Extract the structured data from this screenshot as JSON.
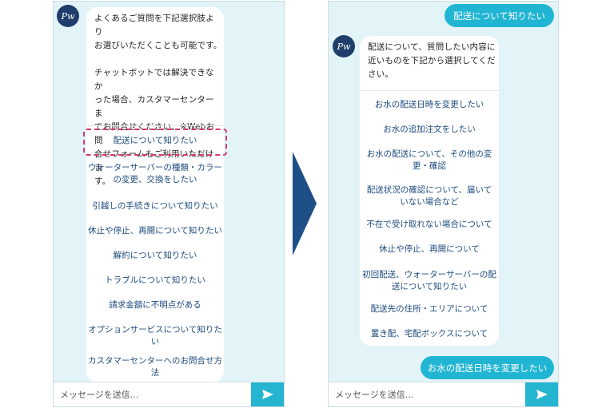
{
  "left_chat": {
    "avatar_text": "Pw",
    "intro_text": "よくあるご質問を下記選択肢より\nお選びいただくことも可能です。\n\nチャットボットでは解決できなか\nった場合、カスタマーセンターま\nでお問合せください。※Webお問\n合せフォームもご利用いただけま\nす。",
    "options": [
      "配送について知りたい",
      "ウォーターサーバーの種類・カラー\nの変更、交換をしたい",
      "引越しの手続きについて知りたい",
      "休止や停止、再開について知りたい",
      "解約について知りたい",
      "トラブルについて知りたい",
      "請求金額に不明点がある",
      "オプションサービスについて知りた\nい",
      "カスタマーセンターへのお問合せ方\n法"
    ],
    "input_placeholder": "メッセージを送信..."
  },
  "right_chat": {
    "user_message_1": "配送について知りたい",
    "avatar_text": "Pw",
    "bot_text": "配送について、質問したい内容に\n近いものを下記から選択してくだ\nさい。",
    "options": [
      "お水の配送日時を変更したい",
      "お水の追加注文をしたい",
      "お水の配送について、その他の変\n更・確認",
      "配送状況の確認について、届いて\nいない場合など",
      "不在で受け取れない場合について",
      "休止や停止、再開について",
      "初回配送、ウォーターサーバーの配\n送について知りたい",
      "配送先の住所・エリアについて",
      "置き配、宅配ボックスについて"
    ],
    "user_message_2": "お水の配送日時を変更したい",
    "input_placeholder": "メッセージを送信..."
  },
  "colors": {
    "panel_bg": "#e3f4f8",
    "accent": "#20b5d3",
    "arrow": "#1f4f87",
    "option_text": "#1c4a7e",
    "highlight_border": "#d8376e"
  },
  "icons": {
    "send": "paper-plane-icon",
    "arrow": "chevron-right-arrow"
  }
}
